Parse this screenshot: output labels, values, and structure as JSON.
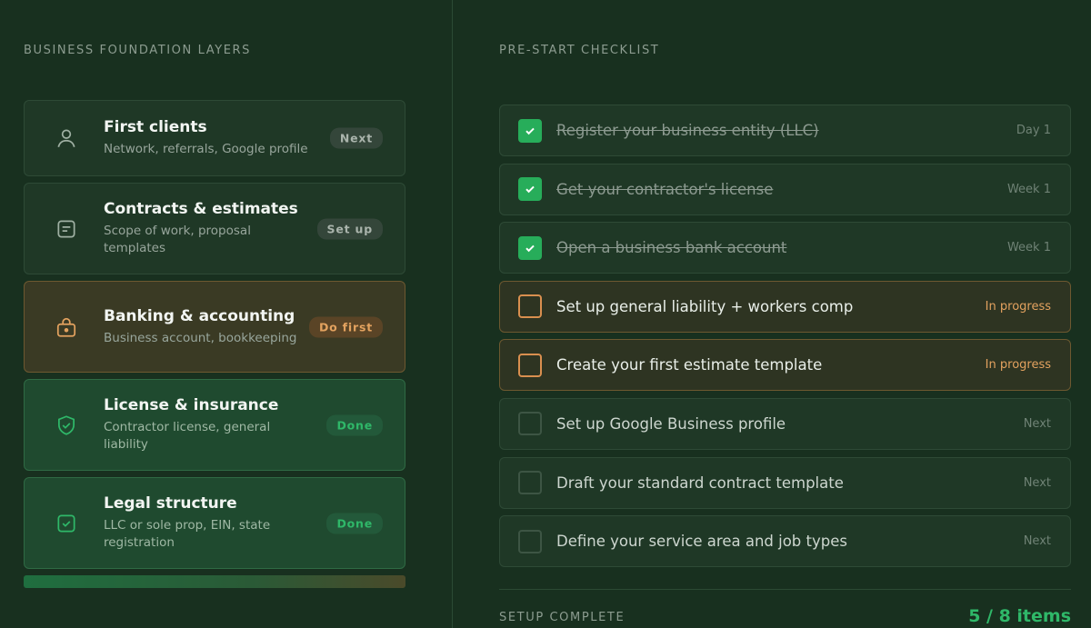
{
  "left": {
    "title": "BUSINESS FOUNDATION LAYERS",
    "layers": [
      {
        "title": "First clients",
        "sub": "Network, referrals, Google profile",
        "badge": "Next",
        "icon": "person-icon",
        "state": "default"
      },
      {
        "title": "Contracts & estimates",
        "sub": "Scope of work, proposal templates",
        "badge": "Set up",
        "icon": "document-icon",
        "state": "default"
      },
      {
        "title": "Banking & accounting",
        "sub": "Business account, bookkeeping",
        "badge": "Do first",
        "icon": "lock-bag-icon",
        "state": "warn"
      },
      {
        "title": "License & insurance",
        "sub": "Contractor license, general liability",
        "badge": "Done",
        "icon": "shield-check-icon",
        "state": "done"
      },
      {
        "title": "Legal structure",
        "sub": "LLC or sole prop, EIN, state registration",
        "badge": "Done",
        "icon": "checkbox-icon",
        "state": "done"
      }
    ]
  },
  "right": {
    "title": "PRE-START CHECKLIST",
    "items": [
      {
        "label": "Register your business entity (LLC)",
        "when": "Day 1",
        "state": "done"
      },
      {
        "label": "Get your contractor's license",
        "when": "Week 1",
        "state": "done"
      },
      {
        "label": "Open a business bank account",
        "when": "Week 1",
        "state": "done"
      },
      {
        "label": "Set up general liability + workers comp",
        "when": "In progress",
        "state": "prog"
      },
      {
        "label": "Create your first estimate template",
        "when": "In progress",
        "state": "prog"
      },
      {
        "label": "Set up Google Business profile",
        "when": "Next",
        "state": "todo"
      },
      {
        "label": "Draft your standard contract template",
        "when": "Next",
        "state": "todo"
      },
      {
        "label": "Define your service area and job types",
        "when": "Next",
        "state": "todo"
      }
    ],
    "footer_label": "SETUP COMPLETE",
    "footer_count": "5 / 8 items"
  },
  "colors": {
    "background": "#18301f",
    "accent_green": "#2fb869",
    "accent_orange": "#e3a25f"
  }
}
